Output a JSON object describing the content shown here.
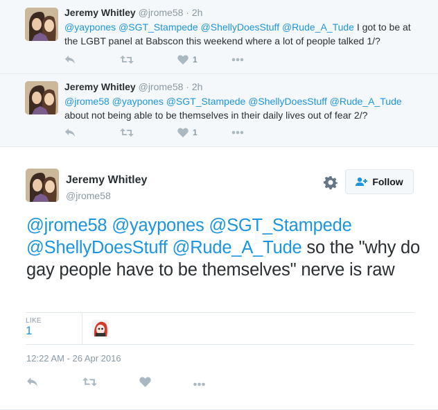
{
  "replies": [
    {
      "name": "Jeremy Whitley",
      "handle": "@jrome58",
      "time": "· 2h",
      "mentions": "@yaypones @SGT_Stampede @ShellyDoesStuff @Rude_A_Tude",
      "text": " I got to be at the LGBT panel at Babscon this weekend where a lot of people talked 1/?",
      "like_count": "1"
    },
    {
      "name": "Jeremy Whitley",
      "handle": "@jrome58",
      "time": "· 2h",
      "mentions": "@jrome58 @yaypones @SGT_Stampede @ShellyDoesStuff @Rude_A_Tude",
      "text": " about not being able to be themselves in their daily lives out of fear 2/?",
      "like_count": "1"
    }
  ],
  "main": {
    "name": "Jeremy Whitley",
    "handle": "@jrome58",
    "follow_label": "Follow",
    "mentions": "@jrome58 @yaypones @SGT_Stampede @ShellyDoesStuff @Rude_A_Tude",
    "text": " so the \"why do gay people have to be themselves\" nerve is raw",
    "like_label": "LIKE",
    "like_count": "1",
    "timestamp": "12:22 AM - 26 Apr 2016"
  },
  "icons": {
    "reply": "reply-icon",
    "retweet": "retweet-icon",
    "like": "heart-icon",
    "more": "more-icon",
    "gear": "gear-icon",
    "follow": "add-user-icon"
  },
  "colors": {
    "link": "#1b95e0",
    "reply_bg": "#f5f8fa",
    "muted": "#8899a6",
    "icon": "#aab8c2"
  }
}
